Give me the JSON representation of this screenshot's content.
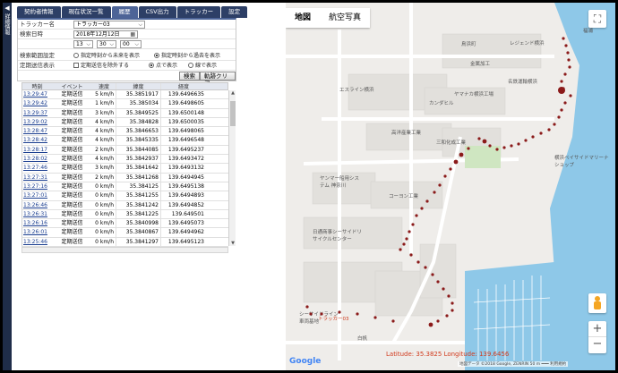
{
  "sidebar": {
    "arrow": "◀",
    "text": "詳細情報"
  },
  "tabs": [
    {
      "label": "契約者情報",
      "active": false
    },
    {
      "label": "現在状況一覧",
      "active": false
    },
    {
      "label": "履歴",
      "active": true
    },
    {
      "label": "CSV出力",
      "active": false
    },
    {
      "label": "トラッカー",
      "active": false
    },
    {
      "label": "設定",
      "active": false
    }
  ],
  "form": {
    "tracker_label": "トラッカー名",
    "tracker_value": "トラッカー03",
    "date_label": "検索日時",
    "date_value": "2018年12月12日",
    "hour": "13",
    "minute": "30",
    "second": "00",
    "range_label": "検索範囲設定",
    "range_opt1": "指定時刻から未来を表示",
    "range_opt2": "指定時刻から過去を表示",
    "display_label": "定期送信表示",
    "display_check": "定期送信を除外する",
    "display_opt1": "点で表示",
    "display_opt2": "線で表示",
    "search_btn": "検索",
    "clear_btn": "軌跡クリア"
  },
  "table": {
    "headers": [
      "時刻",
      "イベント",
      "速度",
      "緯度",
      "経度"
    ],
    "rows": [
      [
        "13:29:47",
        "定期送信",
        "5 km/h",
        "35.3851917",
        "139.6496635"
      ],
      [
        "13:29:42",
        "定期送信",
        "1 km/h",
        "35.385034",
        "139.6498605"
      ],
      [
        "13:29:37",
        "定期送信",
        "3 km/h",
        "35.3849525",
        "139.6500148"
      ],
      [
        "13:29:02",
        "定期送信",
        "4 km/h",
        "35.384828",
        "139.6500035"
      ],
      [
        "13:28:47",
        "定期送信",
        "4 km/h",
        "35.3846653",
        "139.6498065"
      ],
      [
        "13:28:42",
        "定期送信",
        "4 km/h",
        "35.3845335",
        "139.6496548"
      ],
      [
        "13:28:17",
        "定期送信",
        "2 km/h",
        "35.3844085",
        "139.6495237"
      ],
      [
        "13:28:02",
        "定期送信",
        "4 km/h",
        "35.3842937",
        "139.6493472"
      ],
      [
        "13:27:46",
        "定期送信",
        "3 km/h",
        "35.3841642",
        "139.6493132"
      ],
      [
        "13:27:31",
        "定期送信",
        "2 km/h",
        "35.3841268",
        "139.6494945"
      ],
      [
        "13:27:16",
        "定期送信",
        "0 km/h",
        "35.384125",
        "139.6495138"
      ],
      [
        "13:27:01",
        "定期送信",
        "0 km/h",
        "35.3841255",
        "139.6494893"
      ],
      [
        "13:26:46",
        "定期送信",
        "0 km/h",
        "35.3841242",
        "139.6494852"
      ],
      [
        "13:26:31",
        "定期送信",
        "0 km/h",
        "35.3841225",
        "139.649501"
      ],
      [
        "13:26:16",
        "定期送信",
        "0 km/h",
        "35.3840998",
        "139.6495073"
      ],
      [
        "13:26:01",
        "定期送信",
        "0 km/h",
        "35.3840867",
        "139.6494962"
      ],
      [
        "13:25:46",
        "定期送信",
        "0 km/h",
        "35.3841297",
        "139.6495123"
      ]
    ]
  },
  "map": {
    "type_map": "地図",
    "type_satellite": "航空写真",
    "fullscreen_icon": "⛶",
    "zoom_in": "+",
    "zoom_out": "−",
    "pegman_icon": "pegman-icon",
    "coords": "Latitude: 35.3825 Longitude: 139.6456",
    "attribution": "地図データ ©2018 Google, ZENRIN  50 m ━━━  利用規約",
    "google_logo": "Google",
    "tracker_label": "トラッカー03",
    "labels": [
      "福浦",
      "レジェンド横浜",
      "鳥浜町",
      "金属加工",
      "名鉄運輸横浜",
      "エスライン横浜",
      "ヤマナカ横浜工場",
      "カンダヒル",
      "高洋産業工業",
      "三和化成工業",
      "横浜ベイサイドマリーナ ショップ",
      "ヤンマー船用システム 神奈川",
      "コーヨン工業",
      "日通商事シーサイドリサイクルセンター",
      "白帆",
      "シーサイドライン車両基地"
    ]
  },
  "colors": {
    "tab": "#2d3f66",
    "tab_active": "#4d6497",
    "water": "#8ec8e8",
    "marker": "#8b1a1a",
    "coords": "#d13b1e"
  }
}
